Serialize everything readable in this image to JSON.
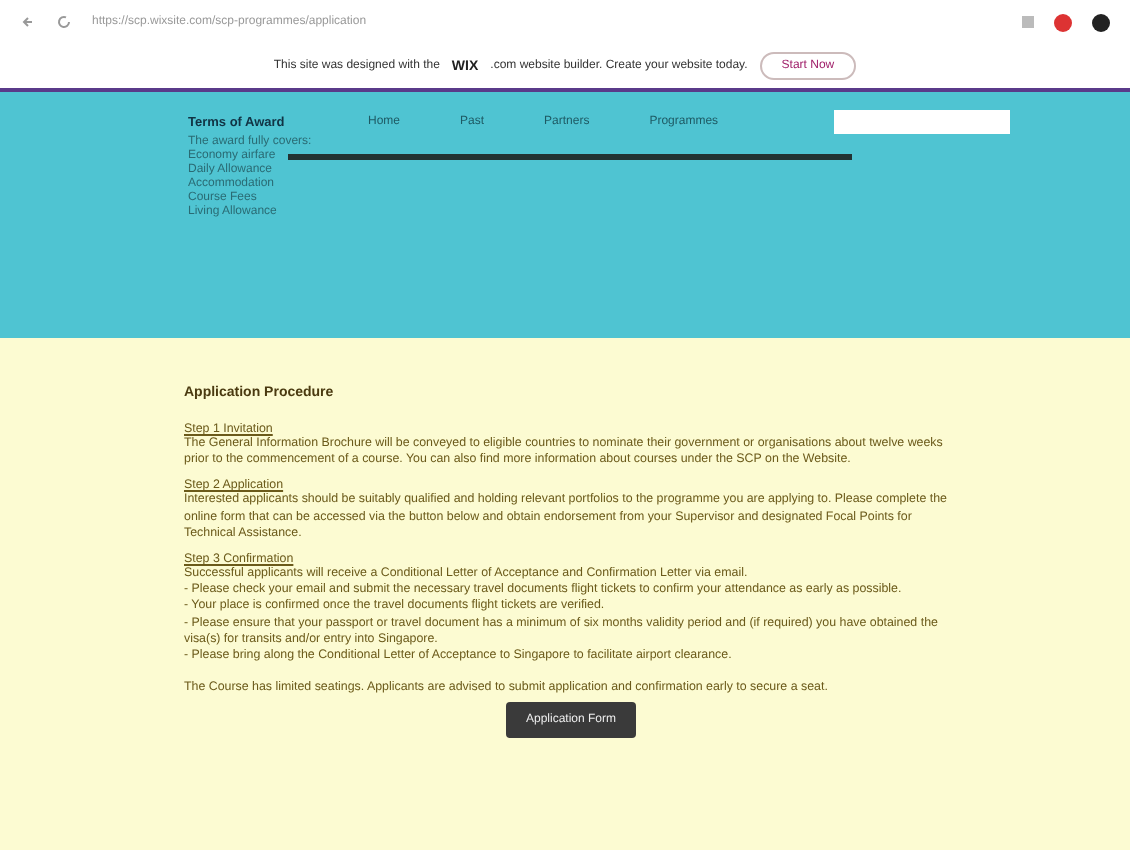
{
  "browser": {
    "url": "https://scp.wixsite.com/scp-programmes/application"
  },
  "wix_banner": {
    "text": "This site was designed with the",
    "logo": "WIX",
    "text_after": ".com website builder. Create your website today.",
    "button": "Start Now"
  },
  "header": {
    "nav": [
      "Home",
      "Past",
      "Partners",
      "Programmes"
    ],
    "award": {
      "title": "Terms of Award",
      "items": [
        "The award fully covers:",
        "Economy airfare",
        "Daily Allowance",
        "Accommodation",
        "Course Fees",
        "Living Allowance"
      ]
    }
  },
  "procedure": {
    "title": "Application Procedure",
    "steps": [
      {
        "heading": "Step 1 Invitation",
        "lines": [
          "The General Information Brochure will be conveyed to eligible countries to nominate their government or organisations about twelve weeks prior to the commencement of a course. You can also find more information about courses under the SCP on the Website."
        ]
      },
      {
        "heading": "Step 2 Application",
        "lines": [
          "Interested applicants should be suitably qualified and holding relevant portfolios to the programme you are applying to. Please complete the online form that can be accessed via the button below and obtain endorsement from your Supervisor and designated Focal Points for Technical Assistance."
        ]
      },
      {
        "heading": "Step 3 Confirmation",
        "lines": [
          "Successful applicants will receive a Conditional Letter of Acceptance and Confirmation Letter via email.",
          "- Please check your email and submit the necessary travel documents flight tickets to confirm your attendance as early as possible.",
          "- Your place is confirmed once the travel documents flight tickets are verified.",
          "- Please ensure that your passport or travel document has a minimum of six months validity period and (if required) you have obtained the visa(s) for transits and/or entry into Singapore.",
          "- Please bring along the Conditional Letter of Acceptance to Singapore to facilitate airport clearance."
        ]
      }
    ],
    "note": "The Course has limited seatings. Applicants are advised to submit application and confirmation early to secure a seat.",
    "button": "Application Form"
  }
}
